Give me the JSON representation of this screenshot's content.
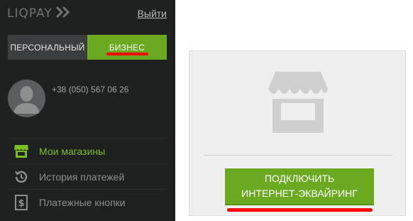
{
  "app": {
    "logo_text": "LIQPAY",
    "logout_label": "Выйти"
  },
  "account_toggle": {
    "personal_label": "ПЕРСОНАЛЬНЫЙ",
    "business_label": "БИЗНЕС",
    "selected": "business"
  },
  "user": {
    "phone": "+38 (050) 567 06 26"
  },
  "nav": {
    "items": [
      {
        "label": "Мои магазины",
        "icon": "shop-icon",
        "active": true
      },
      {
        "label": "История платежей",
        "icon": "history-icon",
        "active": false
      },
      {
        "label": "Платежные кнопки",
        "icon": "dollar-icon",
        "active": false
      }
    ]
  },
  "main": {
    "connect_line1": "ПОДКЛЮЧИТЬ",
    "connect_line2": "ИНТЕРНЕТ-ЭКВАЙРИНГ",
    "shop_illustration": "shop-awning-icon"
  },
  "colors": {
    "sidebar_bg": "#1f2121",
    "accent_green": "#6aa920",
    "active_text": "#7bc022",
    "highlight_red": "#ff0000",
    "card_bg": "#efefef"
  }
}
